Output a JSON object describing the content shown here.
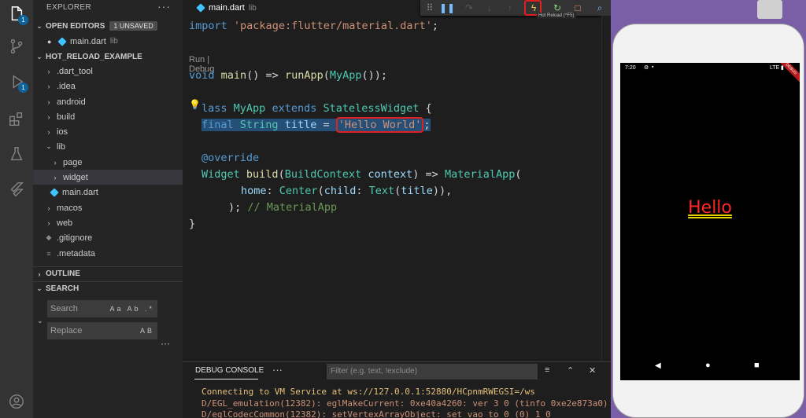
{
  "colors": {
    "accent": "#0e639c",
    "highlight_box": "#e02020",
    "hello_text": "#ff2626"
  },
  "activity_bar": {
    "items": [
      {
        "icon": "files-icon",
        "badge": "1"
      },
      {
        "icon": "source-control-icon",
        "badge": ""
      },
      {
        "icon": "run-debug-icon",
        "badge": "1"
      },
      {
        "icon": "extensions-icon",
        "badge": ""
      },
      {
        "icon": "flask-icon",
        "badge": ""
      },
      {
        "icon": "flutter-icon",
        "badge": ""
      }
    ],
    "account_icon": "account-icon",
    "settings_icon": "gear-icon"
  },
  "sidebar": {
    "title": "EXPLORER",
    "more": "···",
    "open_editors": {
      "label": "OPEN EDITORS",
      "badge": "1 UNSAVED",
      "file": "main.dart",
      "folder": "lib"
    },
    "project": {
      "label": "HOT_RELOAD_EXAMPLE"
    },
    "tree": [
      {
        "name": ".dart_tool"
      },
      {
        "name": ".idea"
      },
      {
        "name": "android"
      },
      {
        "name": "build"
      },
      {
        "name": "ios"
      },
      {
        "name": "lib"
      },
      {
        "name": "page"
      },
      {
        "name": "widget"
      },
      {
        "name": "main.dart"
      },
      {
        "name": "macos"
      },
      {
        "name": "web"
      },
      {
        "name": ".gitignore"
      },
      {
        "name": ".metadata"
      }
    ],
    "outline": "OUTLINE",
    "search_section": "SEARCH",
    "search": {
      "placeholder": "Search",
      "options": "Aa Ab .*"
    },
    "replace": {
      "placeholder": "Replace",
      "options": "AB"
    },
    "dots": "···"
  },
  "editor": {
    "tab": {
      "file": "main.dart",
      "folder": "lib"
    },
    "tooltip": "Hot Reload (^F5)",
    "codelens": "Run | Debug",
    "lines": {
      "l1_kw": "import",
      "l1_str": "'package:flutter/material.dart'",
      "l1_end": ";",
      "l2_kw": "void",
      "l2_fn": "main",
      "l2_a": "() => ",
      "l2_fn2": "runApp",
      "l2_b": "(",
      "l2_cls": "MyApp",
      "l2_c": "());",
      "l3_a": "lass",
      "l3_cls": "MyApp",
      "l3_kw": "extends",
      "l3_cls2": "StatelessWidget",
      "l3_b": " {",
      "l4_kw": "final",
      "l4_type": "String",
      "l4_var": "title",
      "l4_eq": " = ",
      "l4_str": "'Hello World'",
      "l4_end": ";",
      "l5": "@override",
      "l6_type": "Widget",
      "l6_fn": "build",
      "l6_a": "(",
      "l6_type2": "BuildContext",
      "l6_var": "context",
      "l6_b": ") => ",
      "l6_cls": "MaterialApp",
      "l6_c": "(",
      "l7_prop": "home",
      "l7_a": ": ",
      "l7_cls": "Center",
      "l7_b": "(",
      "l7_prop2": "child",
      "l7_c": ": ",
      "l7_cls2": "Text",
      "l7_d": "(",
      "l7_var": "title",
      "l7_e": ")),",
      "l8_a": "); ",
      "l8_cmt": "// MaterialApp",
      "l9": "}"
    }
  },
  "panel": {
    "tab": "DEBUG CONSOLE",
    "more": "···",
    "filter_placeholder": "Filter (e.g. text, !exclude)",
    "logs": [
      "Connecting to VM Service at ws://127.0.0.1:52880/HCpnmRWEGSI=/ws",
      "D/EGL_emulation(12382): eglMakeCurrent: 0xe40a4260: ver 3 0 (tinfo 0xe2e873a0)",
      "D/eglCodecCommon(12382): setVertexArrayObject: set vao to 0 (0) 1 0"
    ]
  },
  "phone": {
    "time": "7:20",
    "network": "LTE",
    "ribbon": "DEBUG",
    "hello": "Hello"
  }
}
